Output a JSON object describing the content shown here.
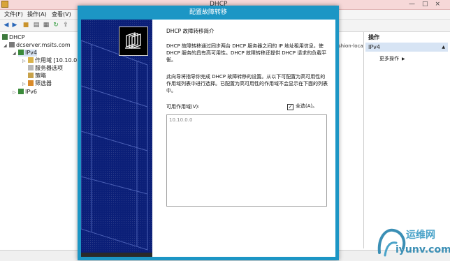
{
  "window": {
    "title": "DHCP",
    "controls": [
      "—",
      "□",
      "×"
    ]
  },
  "menu": [
    "文件(F)",
    "操作(A)",
    "查看(V)"
  ],
  "toolbar": {
    "icons": [
      "back-icon",
      "forward-icon",
      "folder-icon",
      "list-icon",
      "properties-icon",
      "refresh-icon",
      "export-icon"
    ]
  },
  "tree": {
    "root": "DHCP",
    "server": "dcserver.msits.com",
    "ipv4": "IPv4",
    "scope": "作用域 [10.10.0.0",
    "server_options": "服务器选项",
    "policies": "策略",
    "filters": "筛选器",
    "ipv6": "IPv6"
  },
  "middle": {
    "truncated_text": "shion-loca"
  },
  "actions": {
    "header": "操作",
    "context": "IPv4",
    "more": "更多操作"
  },
  "dialog": {
    "title": "配置故障转移",
    "heading": "DHCP 故障转移简介",
    "para1": "DHCP 故障转移通过同步两台 DHCP 服务器之间的 IP 地址租用信息，使 DHCP 服务的具有高可用性。DHCP 故障转移还提供 DHCP 请求的负载平衡。",
    "para2": "此向导将指导你完成 DHCP 故障转移的设置。从以下可配置为高可用性的作用域列表中进行选择。已配置为高可用性的作用域不会显示在下面的列表中。",
    "scopes_label": "可用作用域(V):",
    "select_all_label": "全选(A)。",
    "select_all_checked": true,
    "scopes": [
      "10.10.0.0"
    ]
  },
  "watermark": {
    "name": "运维网",
    "url": "iyunv.com"
  }
}
